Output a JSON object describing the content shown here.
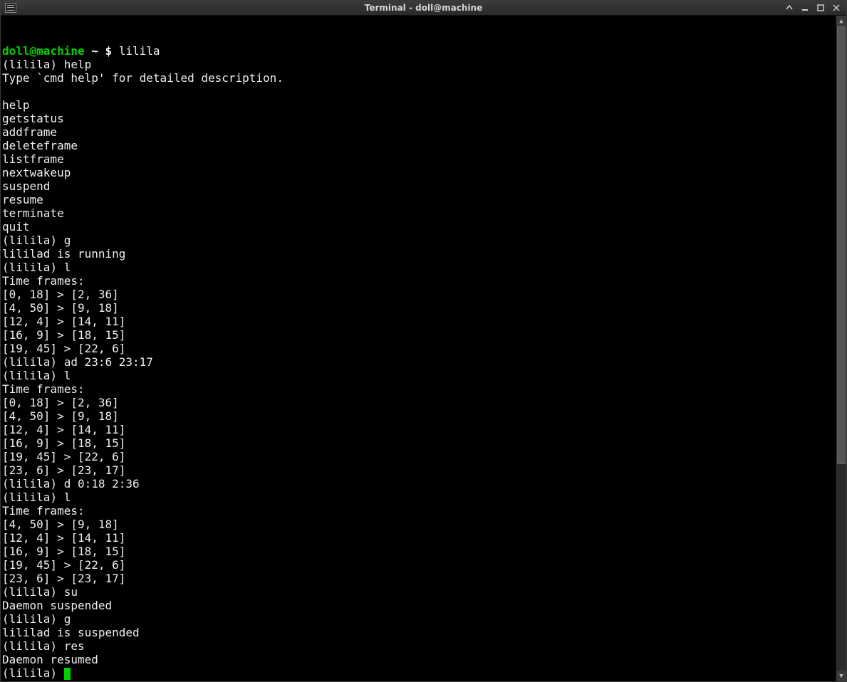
{
  "window": {
    "title": "Terminal - doll@machine"
  },
  "prompt": {
    "user_host": "doll@machine",
    "path": " ~ ",
    "symbol": "$ ",
    "command": "lilila"
  },
  "session": {
    "help": {
      "prefix": "(lilila) ",
      "cmd": "help",
      "hint": "Type `cmd help' for detailed description.",
      "commands": [
        "help",
        "getstatus",
        "addframe",
        "deleteframe",
        "listframe",
        "nextwakeup",
        "suspend",
        "resume",
        "terminate",
        "quit"
      ]
    },
    "g1": {
      "prefix": "(lilila) ",
      "cmd": "g",
      "out": "lililad is running"
    },
    "l1": {
      "prefix": "(lilila) ",
      "cmd": "l",
      "header": "Time frames:",
      "rows": [
        "[0, 18] > [2, 36]",
        "[4, 50] > [9, 18]",
        "[12, 4] > [14, 11]",
        "[16, 9] > [18, 15]",
        "[19, 45] > [22, 6]"
      ]
    },
    "ad": {
      "prefix": "(lilila) ",
      "cmd": "ad 23:6 23:17"
    },
    "l2": {
      "prefix": "(lilila) ",
      "cmd": "l",
      "header": "Time frames:",
      "rows": [
        "[0, 18] > [2, 36]",
        "[4, 50] > [9, 18]",
        "[12, 4] > [14, 11]",
        "[16, 9] > [18, 15]",
        "[19, 45] > [22, 6]",
        "[23, 6] > [23, 17]"
      ]
    },
    "d": {
      "prefix": "(lilila) ",
      "cmd": "d 0:18 2:36"
    },
    "l3": {
      "prefix": "(lilila) ",
      "cmd": "l",
      "header": "Time frames:",
      "rows": [
        "[4, 50] > [9, 18]",
        "[12, 4] > [14, 11]",
        "[16, 9] > [18, 15]",
        "[19, 45] > [22, 6]",
        "[23, 6] > [23, 17]"
      ]
    },
    "su": {
      "prefix": "(lilila) ",
      "cmd": "su",
      "out": "Daemon suspended"
    },
    "g2": {
      "prefix": "(lilila) ",
      "cmd": "g",
      "out": "lililad is suspended"
    },
    "res": {
      "prefix": "(lilila) ",
      "cmd": "res",
      "out": "Daemon resumed"
    },
    "final": {
      "prefix": "(lilila) "
    }
  }
}
